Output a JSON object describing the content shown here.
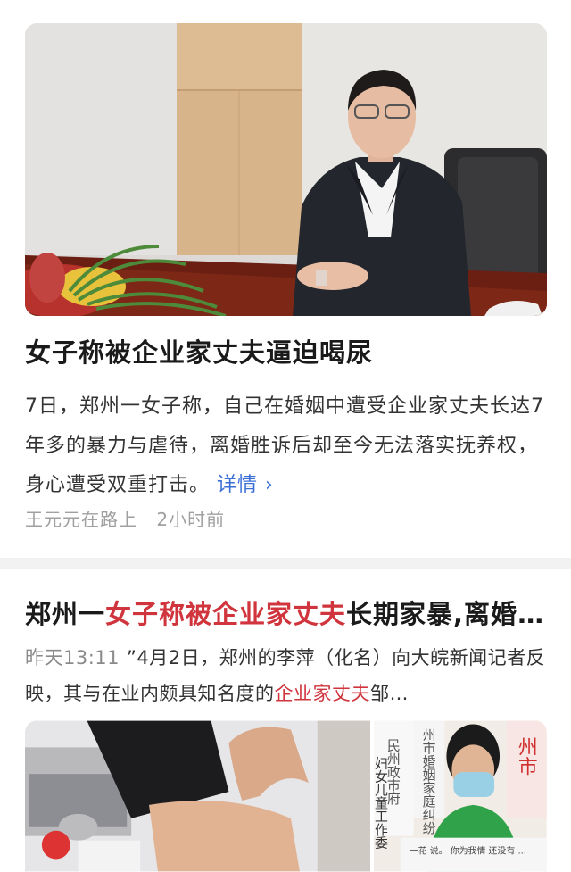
{
  "article1": {
    "image_alt": "男子坐在办公桌前",
    "title": "女子称被企业家丈夫逼迫喝尿",
    "summary": "7日，郑州一女子称，自己在婚姻中遭受企业家丈夫长达7年多的暴力与虐待，离婚胜诉后却至今无法落实抚养权，身心遭受双重打击。",
    "detail_link": "详情 ›",
    "source": "王元元在路上",
    "time": "2小时前"
  },
  "article2": {
    "title_part1": "郑州一",
    "title_highlight": "女子称被企业家丈夫",
    "title_part2": "长期家暴,离婚胜诉后却难获抚养权",
    "time": "昨天13:11",
    "snippet_part1": "”4月2日，郑州的李萍（化名）向大皖新闻记者反映，其与在业内颇具知名度的",
    "snippet_highlight": "企业家丈夫",
    "snippet_part2": "邹…",
    "sign_vertical_1": "民州政市府",
    "sign_vertical_2": "妇女儿童工作委",
    "sign_vertical_3": "州市婚姻家庭纠纷",
    "sign_red": "州市",
    "paper_note": "一花 说。 你为我情 还没有 ..."
  }
}
